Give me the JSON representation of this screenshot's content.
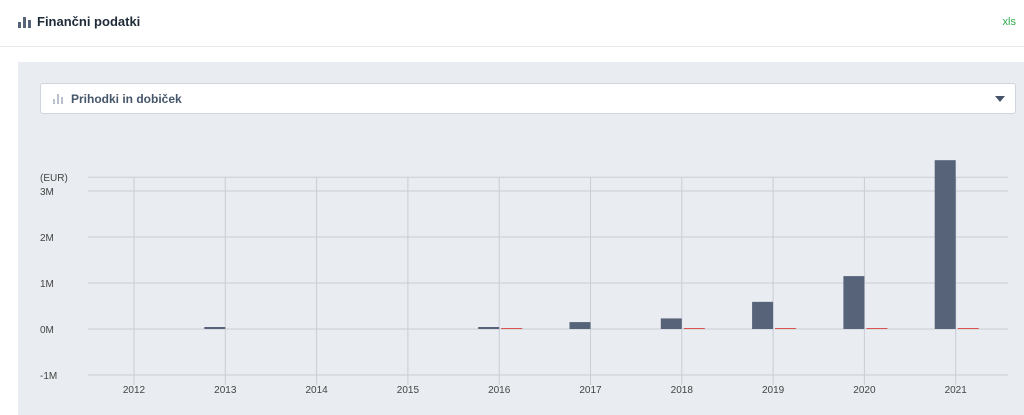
{
  "header": {
    "title": "Finančni podatki",
    "xls_label": "xls",
    "icon": "bar-chart-icon"
  },
  "selector": {
    "label": "Prihodki in dobiček",
    "icon": "bar-chart-icon",
    "dropdown_icon": "chevron-down-icon"
  },
  "colors": {
    "revenue": "#566379",
    "profit": "#d9534f",
    "accent_green": "#2eab4a"
  },
  "chart_data": {
    "type": "bar",
    "ylabel": "(EUR)",
    "categories": [
      "2012",
      "2013",
      "2014",
      "2015",
      "2016",
      "2017",
      "2018",
      "2019",
      "2020",
      "2021"
    ],
    "series": [
      {
        "values": [
          0,
          40000,
          0,
          0,
          30000,
          150000,
          230000,
          590000,
          1150000,
          3670000
        ]
      },
      {
        "values": [
          0,
          0,
          0,
          0,
          5000,
          0,
          5000,
          15000,
          15000,
          15000
        ]
      }
    ],
    "ylim": [
      -1000000,
      4000000
    ],
    "yticks": [
      -1000000,
      0,
      1000000,
      2000000,
      3000000
    ],
    "ytick_labels": [
      "-1M",
      "0M",
      "1M",
      "2M",
      "3M"
    ],
    "grid": true
  }
}
